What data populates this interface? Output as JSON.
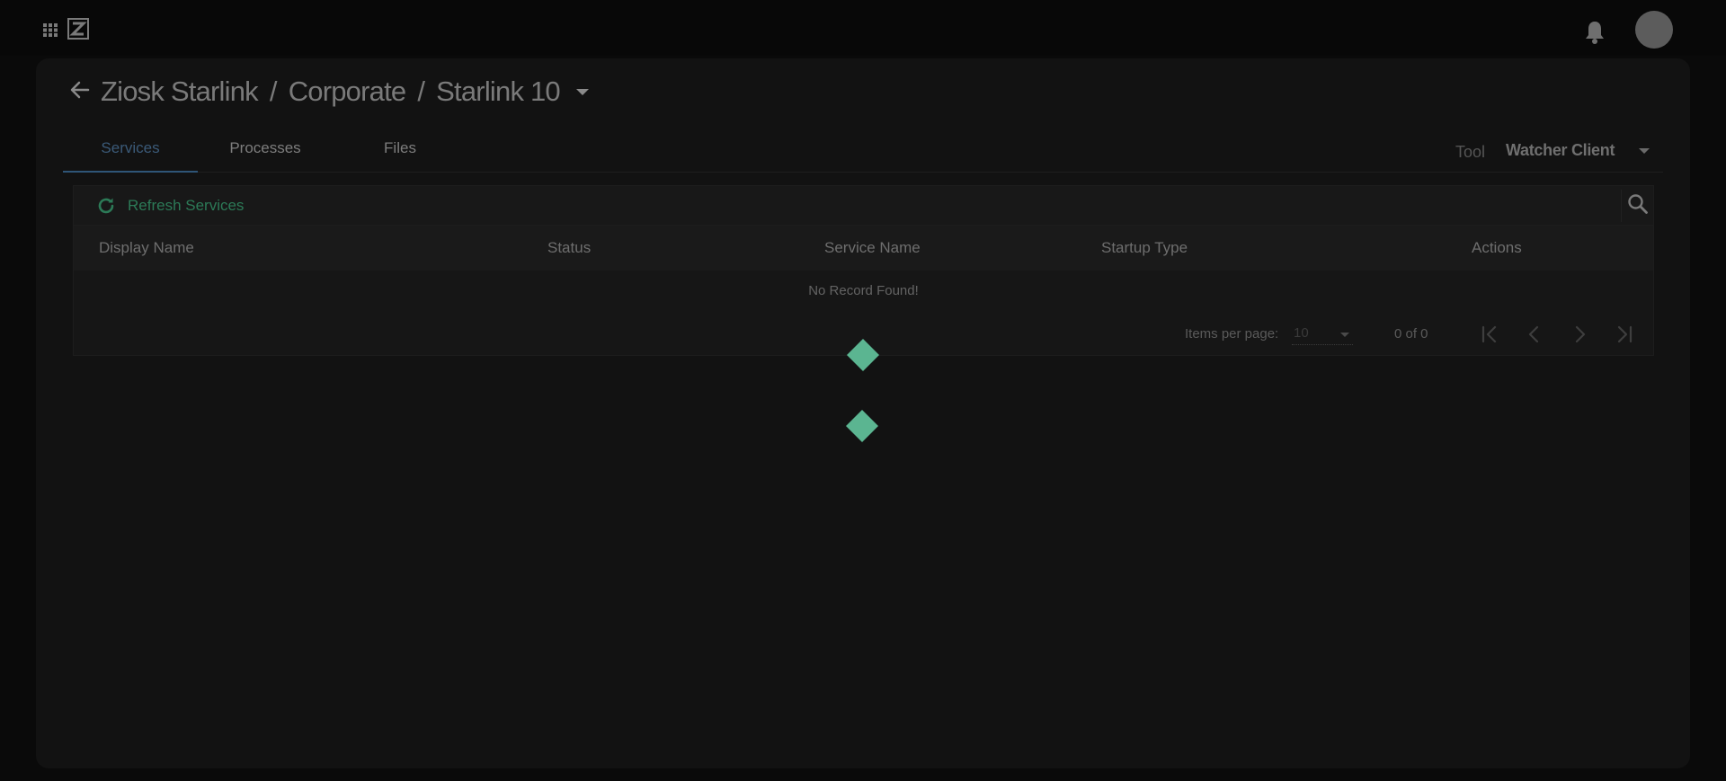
{
  "colors": {
    "background": "#0a0a0a",
    "card": "#121212",
    "accent_green": "#2c7a57",
    "loader_green": "#5bb591",
    "active_tab": "#3b5a78"
  },
  "topbar": {
    "apps_icon": "apps-grid-icon",
    "logo_icon": "ziosk-logo-icon",
    "notification_icon": "bell-icon",
    "avatar_icon": "user-avatar"
  },
  "header": {
    "back_icon": "arrow-left-icon",
    "breadcrumb": [
      "Ziosk Starlink",
      "Corporate",
      "Starlink 10"
    ],
    "separator": "/",
    "dropdown_icon": "caret-down-icon"
  },
  "tabs": [
    {
      "label": "Services",
      "active": true
    },
    {
      "label": "Processes",
      "active": false
    },
    {
      "label": "Files",
      "active": false
    }
  ],
  "tool": {
    "label": "Tool",
    "value": "Watcher Client"
  },
  "table": {
    "refresh_label": "Refresh Services",
    "refresh_icon": "refresh-icon",
    "search_icon": "search-icon",
    "columns": [
      "Display Name",
      "Status",
      "Service Name",
      "Startup Type",
      "Actions"
    ],
    "empty_message": "No Record Found!"
  },
  "paginator": {
    "items_per_page_label": "Items per page:",
    "items_per_page": "10",
    "range": "0 of 0",
    "icons": [
      "first-page-icon",
      "previous-page-icon",
      "next-page-icon",
      "last-page-icon"
    ]
  },
  "loader": {
    "icon": "diamond-loader-icon"
  }
}
